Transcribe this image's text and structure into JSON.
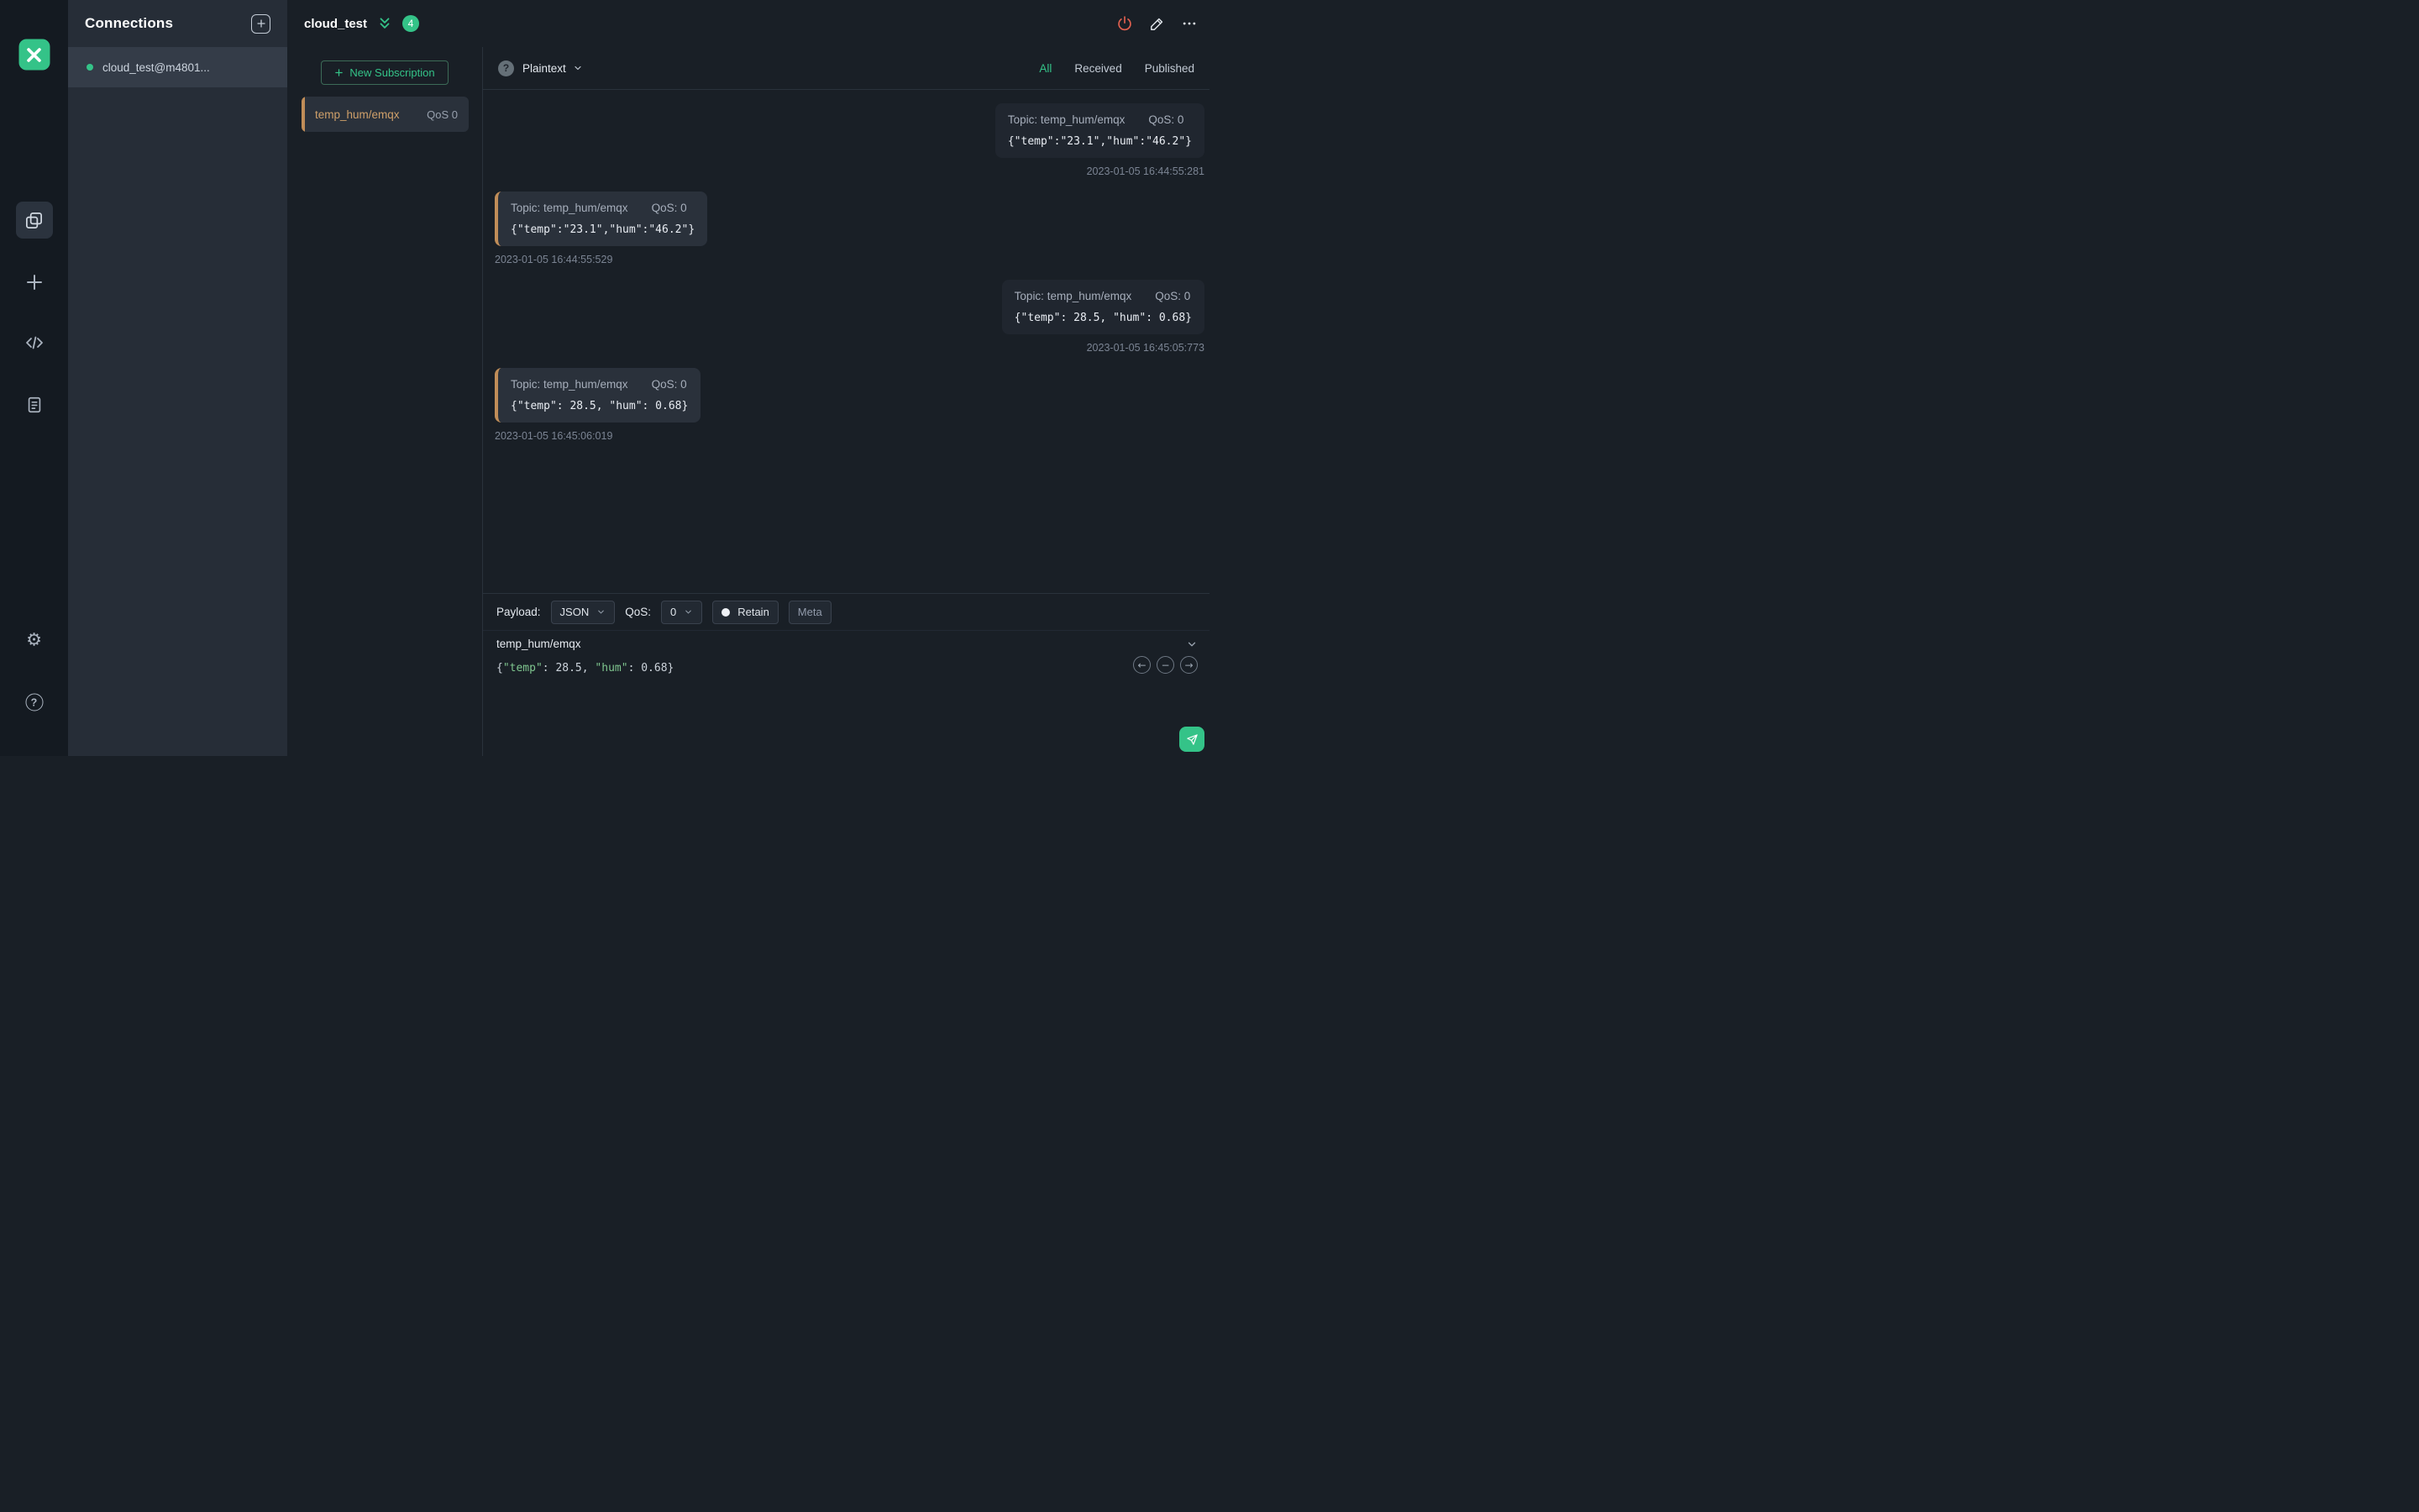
{
  "colors": {
    "accent_green": "#34c388",
    "topic_orange": "#c08d58",
    "danger_red": "#e0604f"
  },
  "connections_panel": {
    "title": "Connections",
    "items": [
      {
        "name": "cloud_test@m4801...",
        "status": "connected"
      }
    ]
  },
  "header": {
    "title": "cloud_test",
    "message_count_badge": "4"
  },
  "subscriptions": {
    "new_subscription_label": "New Subscription",
    "items": [
      {
        "topic": "temp_hum/emqx",
        "qos": "QoS 0"
      }
    ]
  },
  "message_bar": {
    "format": "Plaintext",
    "filters": {
      "all": "All",
      "received": "Received",
      "published": "Published"
    },
    "active_filter": "All"
  },
  "messages": [
    {
      "direction": "published",
      "topic": "Topic: temp_hum/emqx",
      "qos": "QoS: 0",
      "payload": "{\"temp\":\"23.1\",\"hum\":\"46.2\"}",
      "timestamp": "2023-01-05 16:44:55:281"
    },
    {
      "direction": "received",
      "topic": "Topic: temp_hum/emqx",
      "qos": "QoS: 0",
      "payload": "{\"temp\":\"23.1\",\"hum\":\"46.2\"}",
      "timestamp": "2023-01-05 16:44:55:529"
    },
    {
      "direction": "published",
      "topic": "Topic: temp_hum/emqx",
      "qos": "QoS: 0",
      "payload": "{\"temp\": 28.5, \"hum\": 0.68}",
      "timestamp": "2023-01-05 16:45:05:773"
    },
    {
      "direction": "received",
      "topic": "Topic: temp_hum/emqx",
      "qos": "QoS: 0",
      "payload": "{\"temp\": 28.5, \"hum\": 0.68}",
      "timestamp": "2023-01-05 16:45:06:019"
    }
  ],
  "publish": {
    "payload_label": "Payload:",
    "payload_format": "JSON",
    "qos_label": "QoS:",
    "qos_value": "0",
    "retain_label": "Retain",
    "meta_label": "Meta",
    "topic_input": "temp_hum/emqx",
    "payload_tokens": [
      {
        "type": "punct",
        "text": "{"
      },
      {
        "type": "key",
        "text": "\"temp\""
      },
      {
        "type": "punct",
        "text": ": "
      },
      {
        "type": "num",
        "text": "28.5"
      },
      {
        "type": "punct",
        "text": ", "
      },
      {
        "type": "key",
        "text": "\"hum\""
      },
      {
        "type": "punct",
        "text": ": "
      },
      {
        "type": "num",
        "text": "0.68"
      },
      {
        "type": "punct",
        "text": "}"
      }
    ]
  }
}
